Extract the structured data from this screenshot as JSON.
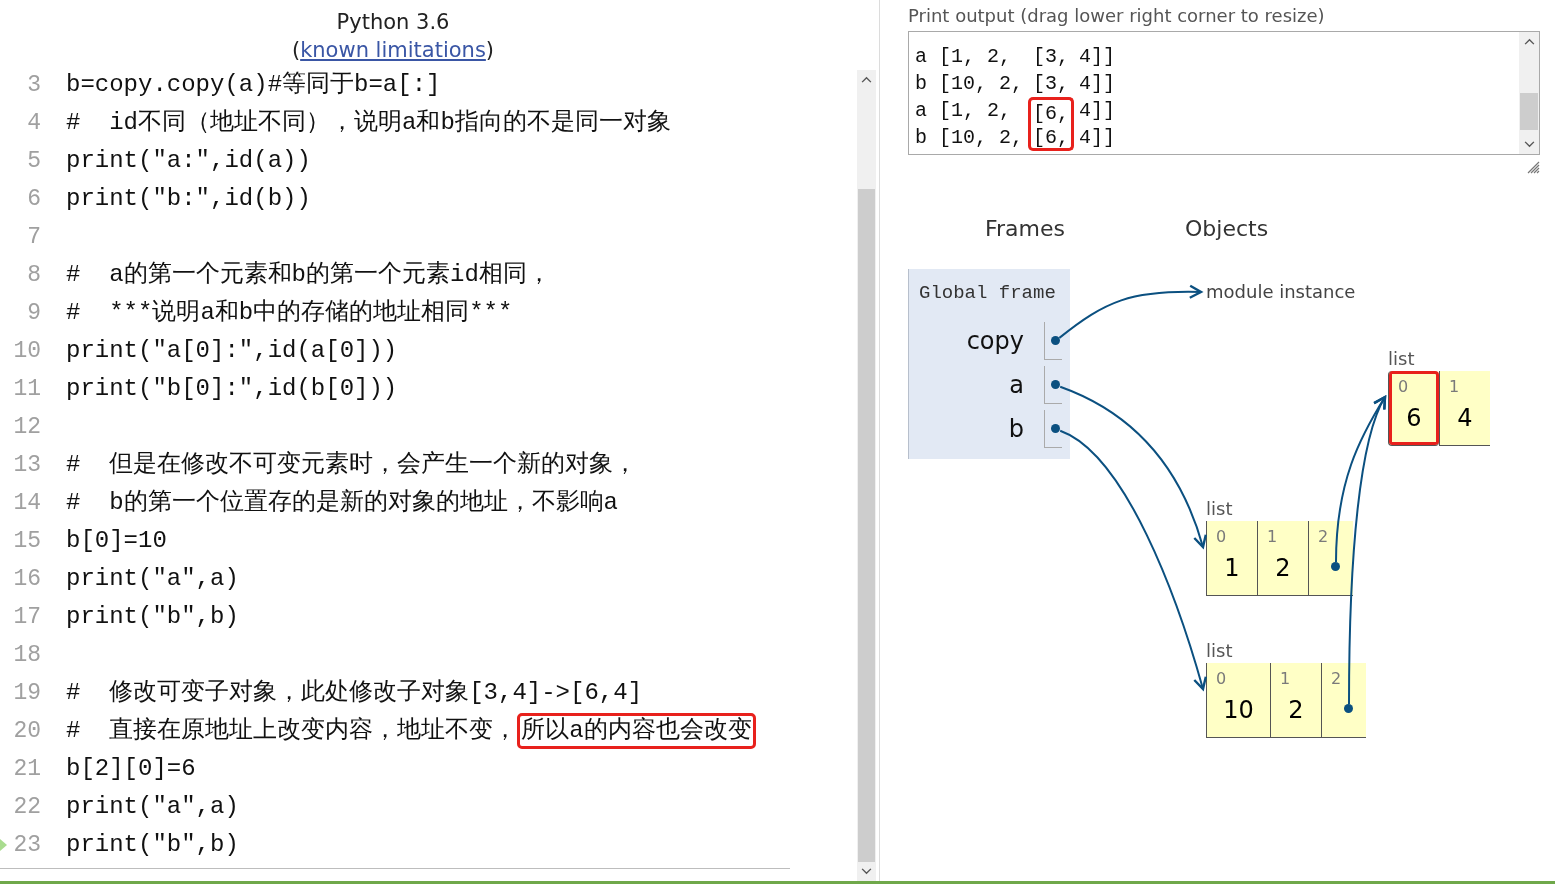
{
  "header": {
    "title": "Python 3.6",
    "link_open": "(",
    "link": "known limitations",
    "link_close": ")"
  },
  "code": {
    "lines": [
      {
        "number": "3",
        "current": false,
        "segments": [
          {
            "text": "b=copy.copy(a)#等同于b=a[:]",
            "marked": false
          }
        ]
      },
      {
        "number": "4",
        "current": false,
        "segments": [
          {
            "text": "#  id不同（地址不同），说明a和b指向的不是同一对象",
            "marked": false
          }
        ]
      },
      {
        "number": "5",
        "current": false,
        "segments": [
          {
            "text": "print(\"a:\",id(a))",
            "marked": false
          }
        ]
      },
      {
        "number": "6",
        "current": false,
        "segments": [
          {
            "text": "print(\"b:\",id(b))",
            "marked": false
          }
        ]
      },
      {
        "number": "7",
        "current": false
      },
      {
        "number": "8",
        "current": false,
        "segments": [
          {
            "text": "#  a的第一个元素和b的第一个元素id相同，",
            "marked": false
          }
        ]
      },
      {
        "number": "9",
        "current": false,
        "segments": [
          {
            "text": "#  ***说明a和b中的存储的地址相同***",
            "marked": false
          }
        ]
      },
      {
        "number": "10",
        "current": false,
        "segments": [
          {
            "text": "print(\"a[0]:\",id(a[0]))",
            "marked": false
          }
        ]
      },
      {
        "number": "11",
        "current": false,
        "segments": [
          {
            "text": "print(\"b[0]:\",id(b[0]))",
            "marked": false
          }
        ]
      },
      {
        "number": "12",
        "current": false
      },
      {
        "number": "13",
        "current": false,
        "segments": [
          {
            "text": "#  但是在修改不可变元素时，会产生一个新的对象，",
            "marked": false
          }
        ]
      },
      {
        "number": "14",
        "current": false,
        "segments": [
          {
            "text": "#  b的第一个位置存的是新的对象的地址，不影响a",
            "marked": false
          }
        ]
      },
      {
        "number": "15",
        "current": false,
        "segments": [
          {
            "text": "b[0]=10",
            "marked": false
          }
        ]
      },
      {
        "number": "16",
        "current": false,
        "segments": [
          {
            "text": "print(\"a\",a)",
            "marked": false
          }
        ]
      },
      {
        "number": "17",
        "current": false,
        "segments": [
          {
            "text": "print(\"b\",b)",
            "marked": false
          }
        ]
      },
      {
        "number": "18",
        "current": false
      },
      {
        "number": "19",
        "current": false,
        "segments": [
          {
            "text": "#  修改可变子对象，此处修改子对象[3,4]->[6,4]",
            "marked": false
          }
        ]
      },
      {
        "number": "20",
        "current": false,
        "segments": [
          {
            "text": "#  直接在原地址上改变内容，地址不变，",
            "marked": false
          },
          {
            "text": "所以a的内容也会改变",
            "marked": true
          }
        ]
      },
      {
        "number": "21",
        "current": false,
        "segments": [
          {
            "text": "b[2][0]=6",
            "marked": false
          }
        ]
      },
      {
        "number": "22",
        "current": false,
        "segments": [
          {
            "text": "print(\"a\",a)",
            "marked": false
          }
        ]
      },
      {
        "number": "23",
        "current": true,
        "segments": [
          {
            "text": "print(\"b\",b)",
            "marked": false
          }
        ]
      }
    ]
  },
  "output": {
    "label": "Print output (drag lower right corner to resize)",
    "lines": [
      {
        "segments": [
          {
            "text": "a [1, 2,",
            "marked": false
          },
          {
            "text": "[3,",
            "marked": false
          },
          {
            "text": "4]]",
            "marked": false
          }
        ]
      },
      {
        "segments": [
          {
            "text": "b [10, 2,",
            "marked": false
          },
          {
            "text": "[3,",
            "marked": false
          },
          {
            "text": "4]]",
            "marked": false
          }
        ]
      },
      {
        "segments": [
          {
            "text": "a [1, 2,",
            "marked": false
          },
          {
            "text": "[6,",
            "marked": true
          },
          {
            "text": "4]]",
            "marked": false
          }
        ]
      },
      {
        "segments": [
          {
            "text": "b [10, 2,",
            "marked": false
          },
          {
            "text": "[6,",
            "marked": true
          },
          {
            "text": "4]]",
            "marked": false
          }
        ]
      }
    ]
  },
  "visualization": {
    "frames_heading": "Frames",
    "objects_heading": "Objects",
    "frame": {
      "name": "Global frame",
      "variables": [
        {
          "name": "copy",
          "kind": "pointer"
        },
        {
          "name": "a",
          "kind": "pointer"
        },
        {
          "name": "b",
          "kind": "pointer"
        }
      ]
    },
    "objects": [
      {
        "kind": "module",
        "label": "module instance"
      },
      {
        "kind": "list",
        "type_label": "list",
        "items": [
          {
            "index": "0",
            "kind": "value",
            "value": "6",
            "marked": true
          },
          {
            "index": "1",
            "kind": "value",
            "value": "4",
            "marked": false
          }
        ]
      },
      {
        "kind": "list",
        "type_label": "list",
        "items": [
          {
            "index": "0",
            "kind": "value",
            "value": "1",
            "marked": false
          },
          {
            "index": "1",
            "kind": "value",
            "value": "2",
            "marked": false
          },
          {
            "index": "2",
            "kind": "pointer",
            "marked": false
          }
        ]
      },
      {
        "kind": "list",
        "type_label": "list",
        "items": [
          {
            "index": "0",
            "kind": "value",
            "value": "10",
            "marked": false
          },
          {
            "index": "1",
            "kind": "value",
            "value": "2",
            "marked": false
          },
          {
            "index": "2",
            "kind": "pointer",
            "marked": false
          }
        ]
      }
    ]
  }
}
